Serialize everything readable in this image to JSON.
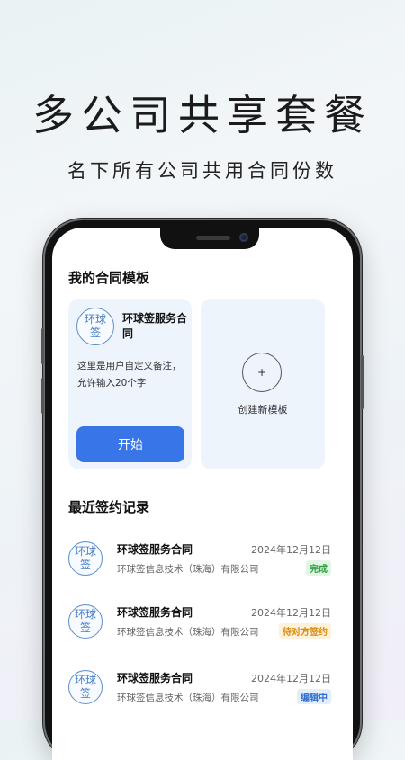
{
  "banner": {
    "headline": "多公司共享套餐",
    "subheadline": "名下所有公司共用合同份数"
  },
  "templates": {
    "section_title": "我的合同模板",
    "card": {
      "seal_text": "环球签",
      "name": "环球签服务合同",
      "note": "这里是用户自定义备注，允许输入20个字",
      "start_label": "开始"
    },
    "create": {
      "plus": "+",
      "label": "创建新模板"
    }
  },
  "records": {
    "section_title": "最近签约记录",
    "items": [
      {
        "seal_text": "环球签",
        "title": "环球签服务合同",
        "company": "环球签信息技术（珠海）有限公司",
        "date": "2024年12月12日",
        "status": "完成"
      },
      {
        "seal_text": "环球签",
        "title": "环球签服务合同",
        "company": "环球签信息技术（珠海）有限公司",
        "date": "2024年12月12日",
        "status": "待对方签约"
      },
      {
        "seal_text": "环球签",
        "title": "环球签服务合同",
        "company": "环球签信息技术（珠海）有限公司",
        "date": "2024年12月12日",
        "status": "编辑中"
      }
    ]
  },
  "colors": {
    "accent": "#3875e6",
    "status_done": "#2f9e44",
    "status_waiting": "#d98b0b",
    "status_editing": "#2f6fd0"
  }
}
